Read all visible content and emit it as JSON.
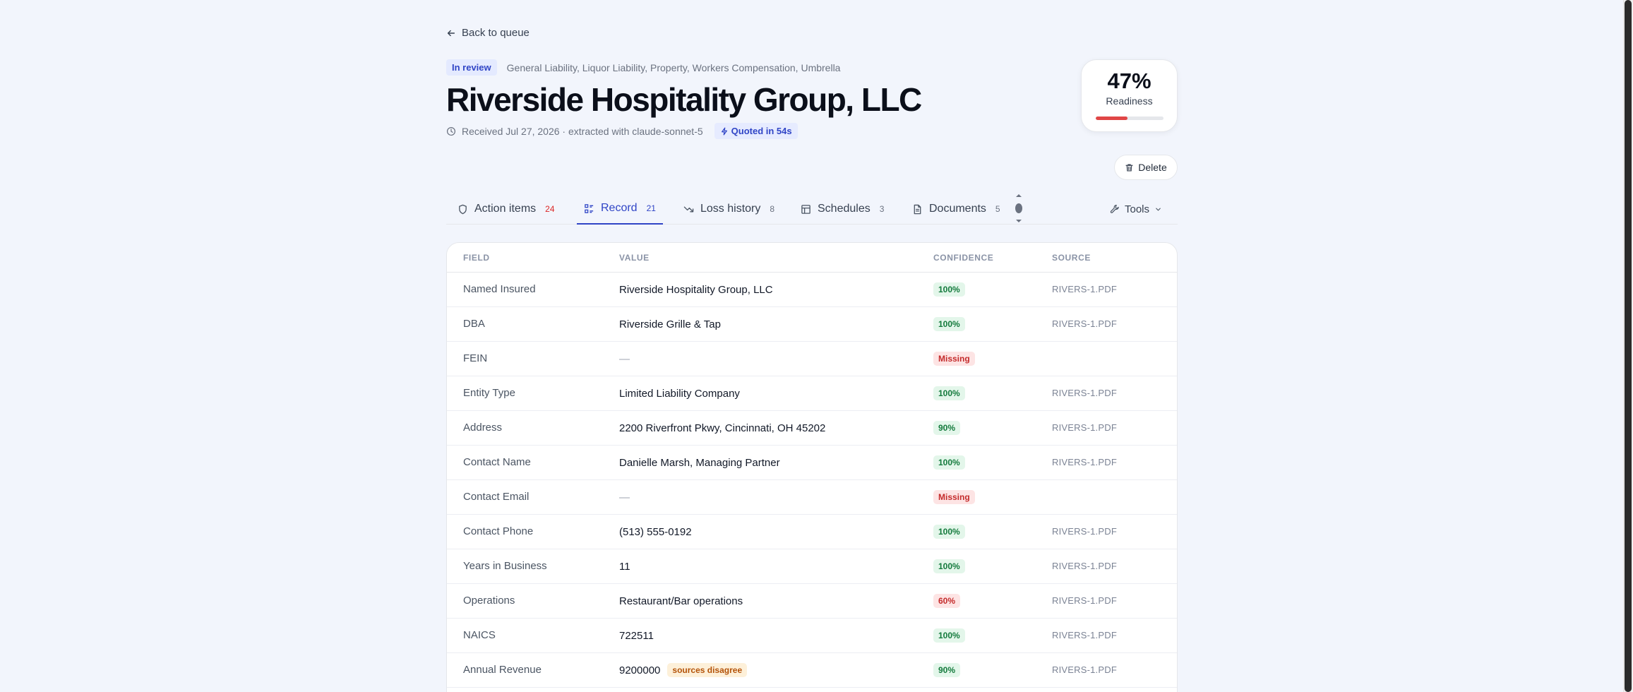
{
  "nav": {
    "back_label": "Back to queue"
  },
  "submission": {
    "status": "In review",
    "lines": "General Liability, Liquor Liability, Property, Workers Compensation, Umbrella",
    "title": "Riverside Hospitality Group, LLC",
    "received": "Received Jul 27, 2026 · extracted with claude-sonnet-5",
    "quoted": "Quoted in 54s"
  },
  "readiness": {
    "percent_label": "47%",
    "label": "Readiness",
    "value": 0.47,
    "bar_color": "#e04646"
  },
  "actions": {
    "delete_label": "Delete",
    "tools_label": "Tools"
  },
  "tabs": [
    {
      "label": "Action items",
      "count": "24",
      "icon": "shield-icon"
    },
    {
      "label": "Record",
      "count": "21",
      "icon": "list-icon",
      "active": true
    },
    {
      "label": "Loss history",
      "count": "8",
      "icon": "trend-down-icon"
    },
    {
      "label": "Schedules",
      "count": "3",
      "icon": "table-icon"
    },
    {
      "label": "Documents",
      "count": "5",
      "icon": "document-icon"
    }
  ],
  "table": {
    "headers": {
      "field": "FIELD",
      "value": "VALUE",
      "confidence": "CONFIDENCE",
      "source": "SOURCE"
    },
    "rows": [
      {
        "field": "Named Insured",
        "value": "Riverside Hospitality Group, LLC",
        "confidence": "100%",
        "level": "green",
        "source": "RIVERS-1.PDF"
      },
      {
        "field": "DBA",
        "value": "Riverside Grille & Tap",
        "confidence": "100%",
        "level": "green",
        "source": "RIVERS-1.PDF"
      },
      {
        "field": "FEIN",
        "value": "—",
        "confidence": "Missing",
        "level": "red",
        "source": ""
      },
      {
        "field": "Entity Type",
        "value": "Limited Liability Company",
        "confidence": "100%",
        "level": "green",
        "source": "RIVERS-1.PDF"
      },
      {
        "field": "Address",
        "value": "2200 Riverfront Pkwy, Cincinnati, OH 45202",
        "confidence": "90%",
        "level": "green",
        "source": "RIVERS-1.PDF"
      },
      {
        "field": "Contact Name",
        "value": "Danielle Marsh, Managing Partner",
        "confidence": "100%",
        "level": "green",
        "source": "RIVERS-1.PDF"
      },
      {
        "field": "Contact Email",
        "value": "—",
        "confidence": "Missing",
        "level": "red",
        "source": ""
      },
      {
        "field": "Contact Phone",
        "value": "(513) 555-0192",
        "confidence": "100%",
        "level": "green",
        "source": "RIVERS-1.PDF"
      },
      {
        "field": "Years in Business",
        "value": "11",
        "confidence": "100%",
        "level": "green",
        "source": "RIVERS-1.PDF"
      },
      {
        "field": "Operations",
        "value": "Restaurant/Bar operations",
        "confidence": "60%",
        "level": "red",
        "source": "RIVERS-1.PDF"
      },
      {
        "field": "NAICS",
        "value": "722511",
        "confidence": "100%",
        "level": "green",
        "source": "RIVERS-1.PDF"
      },
      {
        "field": "Annual Revenue",
        "value": "9200000",
        "flag": "sources disagree",
        "confidence": "90%",
        "level": "green",
        "source": "RIVERS-1.PDF"
      }
    ]
  }
}
